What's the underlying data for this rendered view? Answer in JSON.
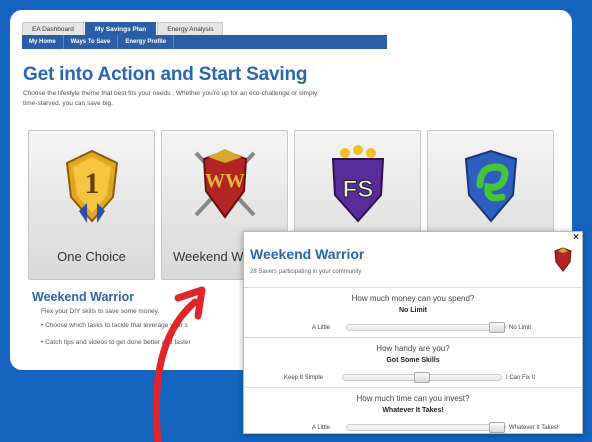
{
  "tabs": [
    "EA Dashboard",
    "My Savings Plan",
    "Energy Analysis"
  ],
  "subnav": [
    "My Home",
    "Ways To Save",
    "Energy Profile"
  ],
  "heading": "Get into Action and Start Saving",
  "intro": "Choose the lifestyle theme that best fits your needs . Whether you're up for an eco-challenge or simply time-starved, you can save big.",
  "cards": {
    "one": "One Choice",
    "two": "Weekend W",
    "three_badge": "FS",
    "one_badge": "1",
    "two_badge": "WW"
  },
  "weekend": {
    "title": "Weekend Warrior",
    "text": "Flex your DIY skills to save some money.",
    "bullets": [
      "Choose which tasks to tackle that leverage your s",
      "Catch tips and videos to get done better and faster"
    ]
  },
  "popup": {
    "close": "×",
    "title": "Weekend Warrior",
    "subtitle": "28 Savers participating in your community",
    "q1": {
      "question": "How much money can you spend?",
      "answer": "No Limit",
      "left": "A Little",
      "right": "No Limit",
      "position": 1.0
    },
    "q2": {
      "question": "How handy are you?",
      "answer": "Got Some Skills",
      "left": "Keep It Simple",
      "right": "I Can Fix It",
      "position": 0.5
    },
    "q3": {
      "question": "How much time can you invest?",
      "answer": "Whatever It Takes!",
      "left": "A Little",
      "right": "Whatever It Takes!",
      "position": 1.0
    }
  }
}
